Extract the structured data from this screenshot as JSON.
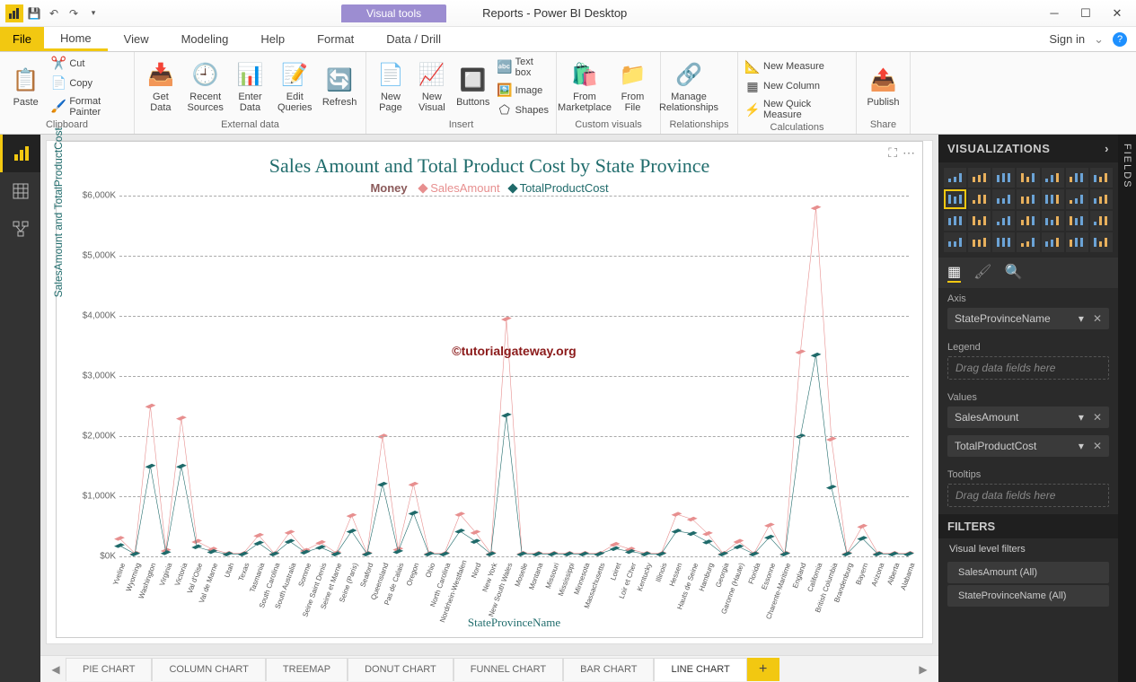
{
  "window": {
    "title": "Reports - Power BI Desktop",
    "tools_tab": "Visual tools",
    "signin": "Sign in"
  },
  "menu": {
    "file": "File",
    "tabs": [
      "Home",
      "View",
      "Modeling",
      "Help",
      "Format",
      "Data / Drill"
    ],
    "active": 0
  },
  "ribbon": {
    "clipboard": {
      "label": "Clipboard",
      "paste": "Paste",
      "cut": "Cut",
      "copy": "Copy",
      "fmt": "Format Painter"
    },
    "external": {
      "label": "External data",
      "get": "Get\nData",
      "recent": "Recent\nSources",
      "enter": "Enter\nData",
      "edit": "Edit\nQueries",
      "refresh": "Refresh"
    },
    "insert": {
      "label": "Insert",
      "newpage": "New\nPage",
      "newvis": "New\nVisual",
      "buttons": "Buttons",
      "textbox": "Text box",
      "image": "Image",
      "shapes": "Shapes"
    },
    "custom": {
      "label": "Custom visuals",
      "market": "From\nMarketplace",
      "file": "From\nFile"
    },
    "rel": {
      "label": "Relationships",
      "manage": "Manage\nRelationships"
    },
    "calc": {
      "label": "Calculations",
      "measure": "New Measure",
      "column": "New Column",
      "quick": "New Quick Measure"
    },
    "share": {
      "label": "Share",
      "publish": "Publish"
    }
  },
  "chart_data": {
    "type": "line",
    "title": "Sales Amount and Total Product Cost by State Province",
    "legend_title": "Money",
    "xlabel": "StateProvinceName",
    "ylabel": "SalesAmount and TotalProductCost",
    "ylim": [
      0,
      6000
    ],
    "yticks": [
      "$0K",
      "$1,000K",
      "$2,000K",
      "$3,000K",
      "$4,000K",
      "$5,000K",
      "$6,000K"
    ],
    "watermark": "©tutorialgateway.org",
    "categories": [
      "Yveline",
      "Wyoming",
      "Washington",
      "Virginia",
      "Victoria",
      "Val d'Oise",
      "Val de Marne",
      "Utah",
      "Texas",
      "Tasmania",
      "South Carolina",
      "South Australia",
      "Somme",
      "Seine Saint Denis",
      "Seine et Marne",
      "Seine (Paris)",
      "Seaford",
      "Queensland",
      "Pas de Calais",
      "Oregon",
      "Ohio",
      "North Carolina",
      "Nordrhein-Westfalen",
      "Nord",
      "New York",
      "New South Wales",
      "Moselle",
      "Montana",
      "Missouri",
      "Mississippi",
      "Minnesota",
      "Massachusetts",
      "Loiret",
      "Loir et Cher",
      "Kentucky",
      "Illinois",
      "Hessen",
      "Hauts de Seine",
      "Hamburg",
      "Georgia",
      "Garonne (Haute)",
      "Florida",
      "Essonne",
      "Charente-Maritime",
      "England",
      "California",
      "British Columbia",
      "Brandenburg",
      "Bayern",
      "Arizona",
      "Alberta",
      "Alabama"
    ],
    "series": [
      {
        "name": "SalesAmount",
        "color": "#e78f8f",
        "values": [
          300,
          50,
          2500,
          100,
          2300,
          250,
          120,
          50,
          50,
          350,
          50,
          400,
          100,
          230,
          60,
          680,
          50,
          2000,
          120,
          1200,
          50,
          50,
          700,
          400,
          50,
          3950,
          50,
          50,
          50,
          50,
          50,
          50,
          200,
          120,
          50,
          50,
          700,
          620,
          380,
          50,
          250,
          50,
          520,
          50,
          3400,
          5800,
          1950,
          50,
          500,
          50,
          50,
          50
        ]
      },
      {
        "name": "TotalProductCost",
        "color": "#1f6a6a",
        "values": [
          180,
          40,
          1500,
          60,
          1500,
          160,
          80,
          40,
          40,
          220,
          40,
          250,
          70,
          150,
          40,
          420,
          40,
          1200,
          80,
          720,
          40,
          40,
          420,
          250,
          40,
          2350,
          40,
          40,
          40,
          40,
          40,
          40,
          130,
          80,
          40,
          40,
          420,
          380,
          240,
          40,
          160,
          40,
          320,
          40,
          2000,
          3350,
          1150,
          40,
          300,
          40,
          40,
          40
        ]
      }
    ]
  },
  "tabs": [
    "PIE CHART",
    "COLUMN CHART",
    "TREEMAP",
    "DONUT CHART",
    "FUNNEL CHART",
    "BAR CHART",
    "LINE CHART"
  ],
  "tab_active": 6,
  "viz_panel": {
    "title": "VISUALIZATIONS",
    "axis_label": "Axis",
    "axis_field": "StateProvinceName",
    "legend_label": "Legend",
    "legend_placeholder": "Drag data fields here",
    "values_label": "Values",
    "values": [
      "SalesAmount",
      "TotalProductCost"
    ],
    "tooltips_label": "Tooltips",
    "tooltips_placeholder": "Drag data fields here",
    "filters_title": "FILTERS",
    "filters_section": "Visual level filters",
    "filter_items": [
      "SalesAmount (All)",
      "StateProvinceName (All)"
    ]
  },
  "fields_panel": {
    "label": "FIELDS"
  }
}
